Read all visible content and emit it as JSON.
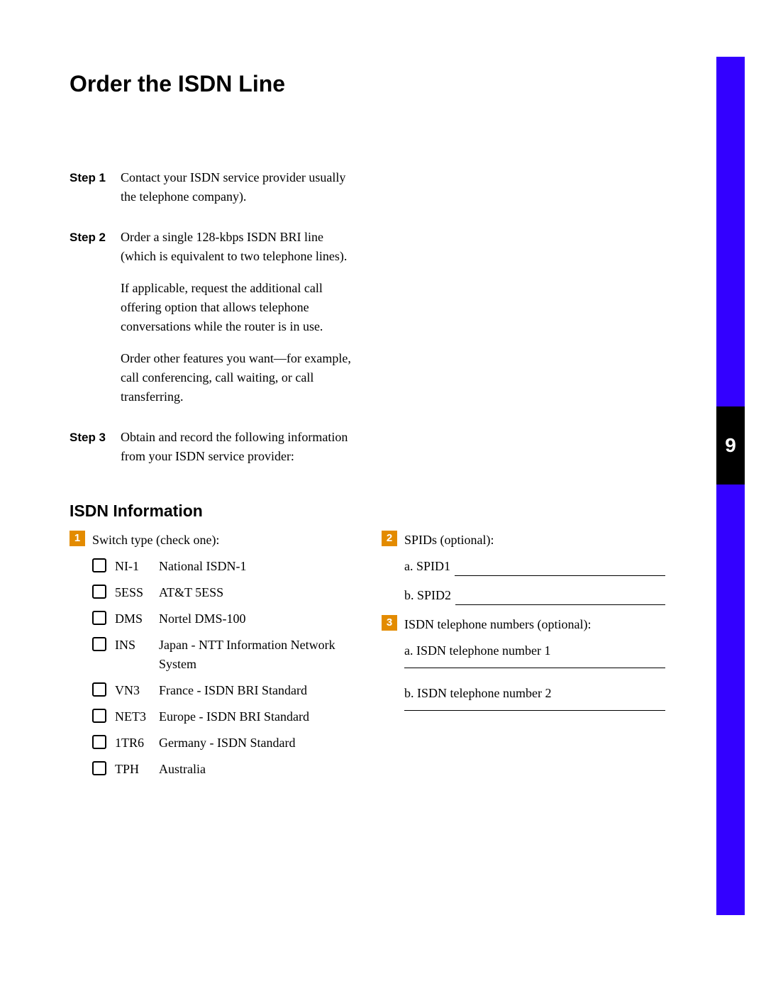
{
  "tab": {
    "page_number": "9"
  },
  "title": "Order the ISDN Line",
  "steps": [
    {
      "label": "Step 1",
      "paras": [
        "Contact your ISDN service provider usually the telephone company)."
      ]
    },
    {
      "label": "Step 2",
      "paras": [
        "Order a single 128-kbps ISDN BRI line (which is equivalent to two telephone lines).",
        "If applicable, request the additional call offering option that allows telephone conversations while the router is in use.",
        "Order other features you want—for example, call conferencing, call waiting, or call transferring."
      ]
    },
    {
      "label": "Step 3",
      "paras": [
        "Obtain and record the following information from your ISDN service provider:"
      ]
    }
  ],
  "section_heading": "ISDN Information",
  "switch_block": {
    "badge": "1",
    "lead": "Switch type (check one):",
    "options": [
      {
        "code": "NI-1",
        "desc": "National ISDN-1"
      },
      {
        "code": "5ESS",
        "desc": "AT&T 5ESS"
      },
      {
        "code": "DMS",
        "desc": "Nortel DMS-100"
      },
      {
        "code": "INS",
        "desc": "Japan - NTT Information Network System"
      },
      {
        "code": "VN3",
        "desc": "France - ISDN BRI Standard"
      },
      {
        "code": "NET3",
        "desc": "Europe - ISDN BRI Standard"
      },
      {
        "code": "1TR6",
        "desc": "Germany - ISDN Standard"
      },
      {
        "code": "TPH",
        "desc": "Australia"
      }
    ]
  },
  "spids_block": {
    "badge": "2",
    "lead": "SPIDs (optional):",
    "lines": [
      {
        "label": "a. SPID1"
      },
      {
        "label": "b. SPID2"
      }
    ]
  },
  "tel_block": {
    "badge": "3",
    "lead": "ISDN telephone numbers (optional):",
    "lines": [
      {
        "label": "a. ISDN telephone number 1"
      },
      {
        "label": "b. ISDN telephone number 2"
      }
    ]
  }
}
